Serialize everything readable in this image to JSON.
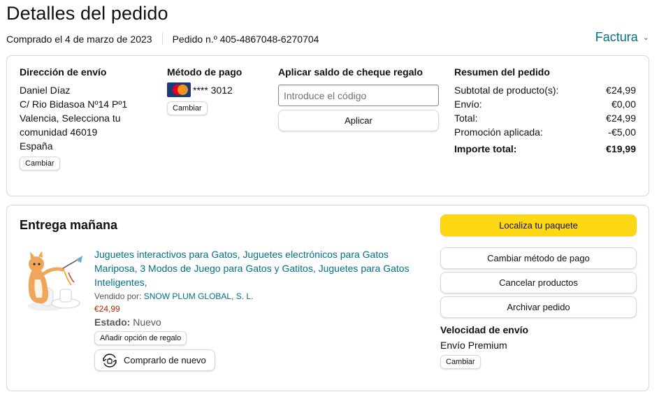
{
  "header": {
    "title": "Detalles del pedido",
    "purchased": "Comprado el 4 de marzo de 2023",
    "order_number": "Pedido n.º 405-4867048-6270704",
    "invoice_label": "Factura"
  },
  "shipping": {
    "title": "Dirección de envío",
    "lines": [
      "Daniel Díaz",
      "C/ Rio Bidasoa Nº14 Pº1",
      "Valencia, Selecciona tu comunidad 46019",
      "España"
    ],
    "change_label": "Cambiar"
  },
  "payment": {
    "title": "Método de pago",
    "card_text": "**** 3012",
    "card_icon": "mastercard-icon",
    "change_label": "Cambiar"
  },
  "gift_card": {
    "title": "Aplicar saldo de cheque regalo",
    "placeholder": "Introduce el código",
    "value": "",
    "apply_label": "Aplicar"
  },
  "summary": {
    "title": "Resumen del pedido",
    "rows": [
      {
        "label": "Subtotal de producto(s):",
        "value": "€24,99"
      },
      {
        "label": "Envío:",
        "value": "€0,00"
      },
      {
        "label": "Total:",
        "value": "€24,99"
      },
      {
        "label": "Promoción aplicada:",
        "value": "-€5,00"
      }
    ],
    "total_label": "Importe total:",
    "total_value": "€19,99"
  },
  "delivery": {
    "title": "Entrega mañana",
    "product": {
      "title": "Juguetes interactivos para Gatos, Juguetes electrónicos para Gatos Mariposa, 3 Modos de Juego para Gatos y Gatitos, Juguetes para Gatos Inteligentes,",
      "seller_label": "Vendido por:",
      "seller_name": "SNOW PLUM GLOBAL, S. L.",
      "price": "€24,99",
      "status_label": "Estado:",
      "status_value": "Nuevo",
      "gift_option_label": "Añadir opción de regalo",
      "buy_again_label": "Comprarlo de nuevo"
    },
    "actions": {
      "track": "Localiza tu paquete",
      "change_payment": "Cambiar método de pago",
      "cancel": "Cancelar productos",
      "archive": "Archivar pedido"
    },
    "shipping_speed": {
      "title": "Velocidad de envío",
      "value": "Envío Premium",
      "change_label": "Cambiar"
    }
  },
  "colors": {
    "link": "#007185",
    "price": "#b12704",
    "primary_button": "#ffd814",
    "border": "#d5d9d9"
  }
}
